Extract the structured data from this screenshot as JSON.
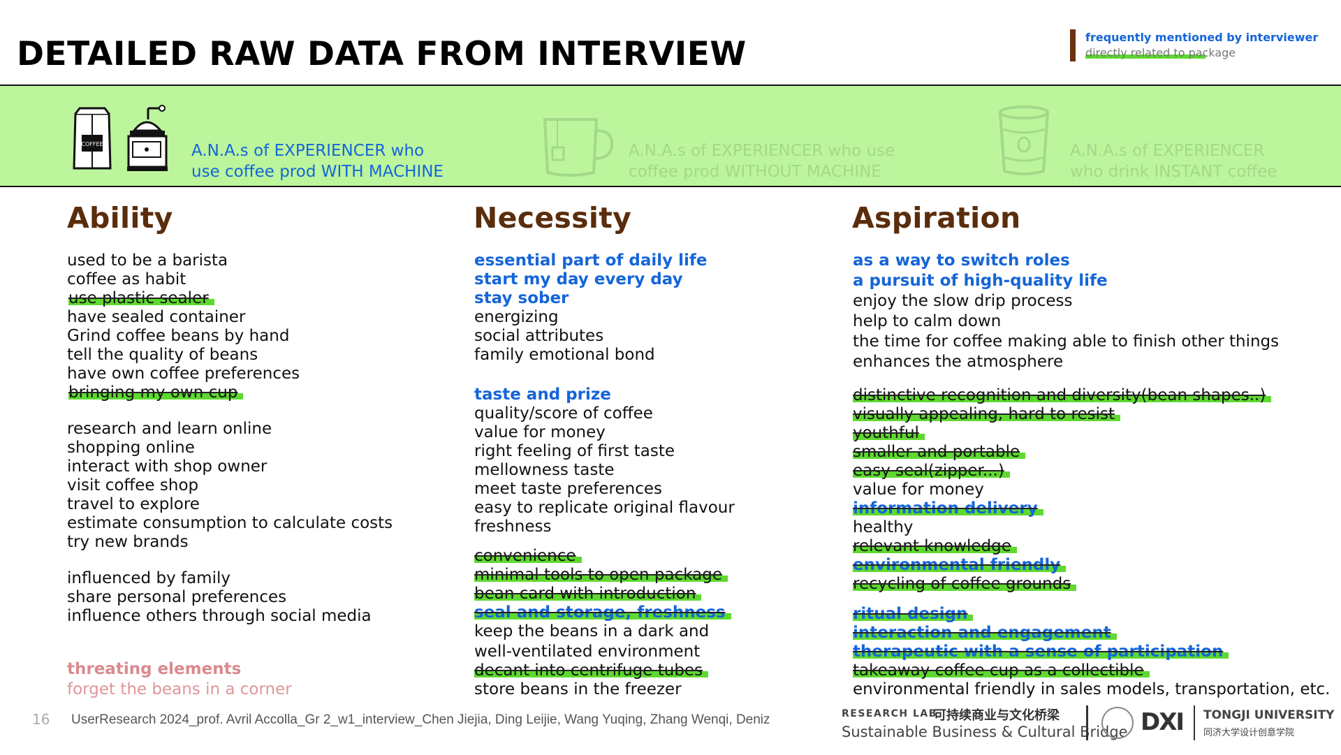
{
  "title": "DETAILED RAW DATA FROM INTERVIEW",
  "legend": {
    "frequently": "frequently mentioned by interviewer",
    "related": "directly related to package"
  },
  "band": {
    "with_machine": [
      "A.N.A.s of EXPERIENCER who",
      "use coffee prod WITH MACHINE"
    ],
    "without_machine": [
      "A.N.A.s of EXPERIENCER who use",
      "coffee prod WITHOUT MACHINE"
    ],
    "instant": [
      "A.N.A.s of EXPERIENCER",
      "who drink INSTANT coffee"
    ],
    "coffee_bag_label": "COFFEE"
  },
  "ability": {
    "heading": "Ability",
    "group1": [
      "used to be a barista",
      "coffee as habit",
      "use plastic sealer",
      "have sealed container",
      "Grind coffee beans by hand",
      "tell the quality of beans",
      "have own coffee preferences",
      "bringing my own cup"
    ],
    "group2": [
      "research and learn online",
      "shopping online",
      "interact with shop owner",
      "visit coffee shop",
      "travel to explore",
      "estimate consumption to calculate costs",
      "try new brands"
    ],
    "group3": [
      "influenced by family",
      "share personal preferences",
      "influence others through social media"
    ],
    "threat_heading": "threating elements",
    "threat": [
      "forget the beans in a corner"
    ]
  },
  "necessity": {
    "heading": "Necessity",
    "group1": [
      "essential part of daily life",
      "start my day every day",
      "stay sober",
      "energizing",
      "social attributes",
      "family emotional bond"
    ],
    "group2": [
      "taste and prize",
      "quality/score of coffee",
      "value for money",
      "right feeling of first taste",
      "mellowness taste",
      "meet taste preferences",
      "easy to replicate original flavour",
      "freshness"
    ],
    "group3": [
      "convenience",
      "minimal tools to open package",
      "bean card with introduction",
      "seal and storage, freshness",
      "keep the beans in a dark and",
      "well-ventilated environment",
      "decant into centrifuge tubes",
      "store beans in the freezer"
    ]
  },
  "aspiration": {
    "heading": "Aspiration",
    "group1": [
      "as a way to switch roles",
      "a pursuit of high-quality life",
      "enjoy the slow drip process",
      "help to calm down",
      "the time for coffee making able to finish other things",
      "enhances the atmosphere"
    ],
    "group2": [
      "distinctive recognition and diversity(bean shapes..)",
      "visually appealing, hard to resist",
      "youthful",
      "smaller and portable",
      "easy seal(zipper...)",
      "value for money",
      "information delivery",
      "healthy",
      "relevant knowledge",
      "environmental friendly",
      "recycling of coffee grounds"
    ],
    "group3": [
      "ritual design",
      "interaction and engagement",
      "therapeutic with a sense of participation",
      "takeaway coffee cup as a collectible",
      "environmental friendly in sales models, transportation, etc."
    ]
  },
  "footer": {
    "page_number": "16",
    "credits": "UserResearch 2024_prof. Avril Accolla_Gr 2_w1_interview_Chen Jiejia, Ding Leijie, Wang Yuqing, Zhang Wenqi, Deniz",
    "lab_label": "RESEARCH LAB",
    "lab_cn": "可持续商业与文化桥梁",
    "lab_en": "Sustainable Business & Cultural Bridge",
    "dxi": "DXI",
    "university": "TONGJI UNIVERSITY",
    "university_cn": "同济大学设计创意学院"
  },
  "colors": {
    "band_green": "#bcf59c",
    "highlight_green": "#5ed92f",
    "heading_brown": "#5a2d0c",
    "blue": "#1565d8",
    "threat_pink": "#d98a8f"
  }
}
